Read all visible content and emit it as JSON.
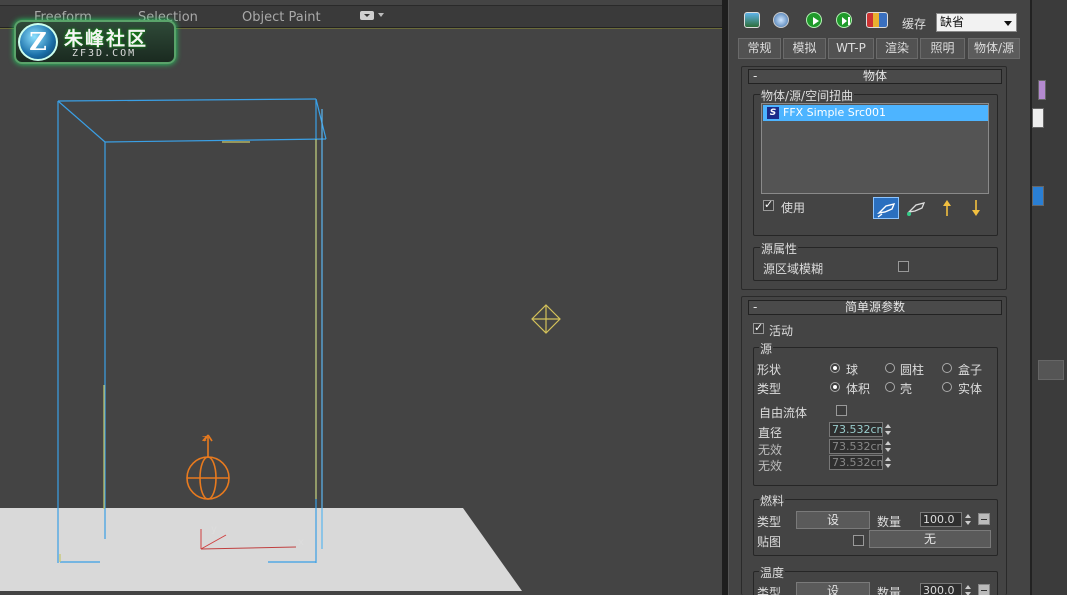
{
  "ribbon": {
    "tabs": [
      "Freeform",
      "Selection",
      "Object Paint"
    ]
  },
  "logo": {
    "badge": "Z",
    "title": "朱峰社区",
    "subtitle": "ZF3D.COM"
  },
  "viewport": {
    "axis_x": "x",
    "axis_y": "y",
    "axis_z": "z"
  },
  "toolbar": {
    "icons": [
      "render-frame-icon",
      "render-setup-icon",
      "play-icon",
      "play-once-icon",
      "library-icon"
    ],
    "cache_label": "缓存",
    "cache_value": "缺省"
  },
  "tabs": [
    "常规",
    "模拟",
    "WT-P",
    "渲染",
    "照明",
    "物体/源"
  ],
  "object_rollout": {
    "title": "物体",
    "minus": "-",
    "group_label": "物体/源/空间扭曲",
    "list_items": [
      {
        "badge": "S",
        "label": "FFX Simple Src001"
      }
    ],
    "use_label": "使用",
    "use_checked": true,
    "source_props_label": "源属性",
    "blur_label": "源区域模糊",
    "blur_checked": false
  },
  "simple_source_rollout": {
    "title": "简单源参数",
    "minus": "-",
    "active_label": "活动",
    "active_checked": true,
    "source_group": "源",
    "shape_label": "形状",
    "shape_options": [
      "球",
      "圆柱",
      "盒子"
    ],
    "shape_selected": "球",
    "type_label": "类型",
    "type_options": [
      "体积",
      "壳",
      "实体"
    ],
    "type_selected": "体积",
    "free_flow_label": "自由流体",
    "free_flow_checked": false,
    "diameter_label": "直径",
    "diameter_value": "73.532cm",
    "invalid1_label": "无效",
    "invalid1_value": "73.532cm",
    "invalid2_label": "无效",
    "invalid2_value": "73.532cm",
    "fuel_group": "燃料",
    "fuel_type_label": "类型",
    "fuel_set_button": "设",
    "fuel_amount_label": "数量",
    "fuel_amount_value": "100.0",
    "fuel_map_label": "贴图",
    "fuel_map_button": "无",
    "temp_group": "温度",
    "temp_type_label": "类型",
    "temp_set_button": "设",
    "temp_amount_label": "数量",
    "temp_amount_value": "300.0"
  }
}
